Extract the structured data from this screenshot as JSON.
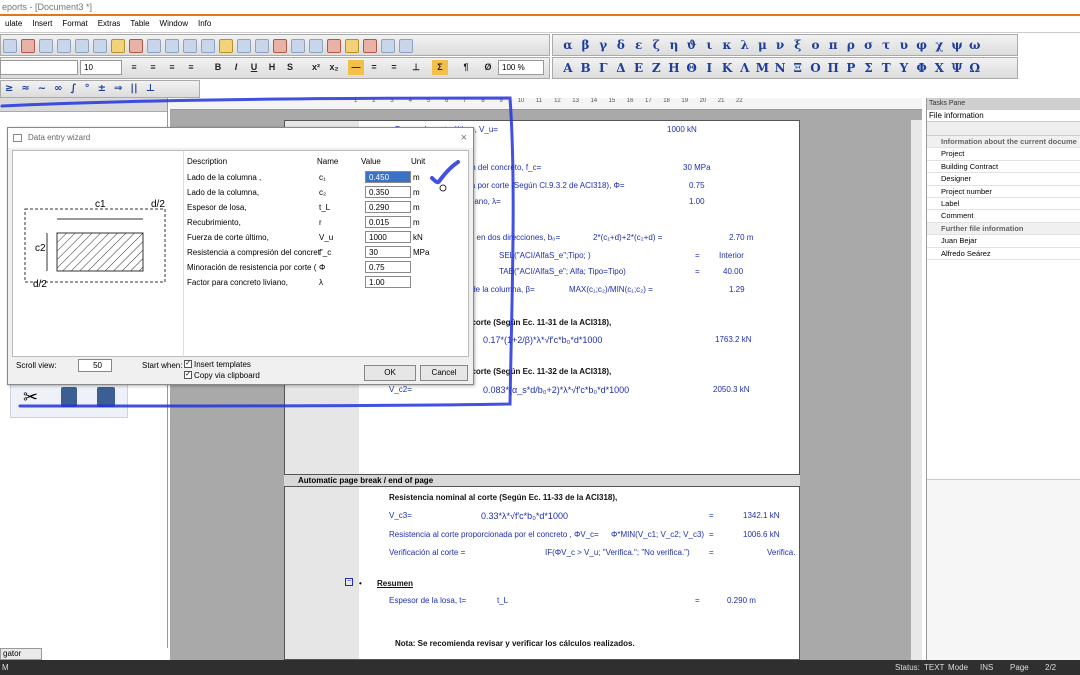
{
  "window": {
    "title": "eports - [Document3 *]"
  },
  "menu": [
    "ulate",
    "Insert",
    "Format",
    "Extras",
    "Table",
    "Window",
    "Info"
  ],
  "toolbar": {
    "font_size": "10",
    "zoom": "100 %"
  },
  "greek_lower": [
    "α",
    "β",
    "γ",
    "δ",
    "ε",
    "ζ",
    "η",
    "ϑ",
    "ι",
    "κ",
    "λ",
    "μ",
    "ν",
    "ξ",
    "ο",
    "π",
    "ρ",
    "σ",
    "τ",
    "υ",
    "φ",
    "χ",
    "ψ",
    "ω"
  ],
  "greek_upper": [
    "Α",
    "Β",
    "Γ",
    "Δ",
    "Ε",
    "Ζ",
    "Η",
    "Θ",
    "Ι",
    "Κ",
    "Λ",
    "Μ",
    "Ν",
    "Ξ",
    "Ο",
    "Π",
    "Ρ",
    "Σ",
    "Τ",
    "Υ",
    "Φ",
    "Χ",
    "Ψ",
    "Ω"
  ],
  "math_symbols": [
    "≥",
    "≈",
    "~",
    "∞",
    "∫",
    "°",
    "±",
    "⇒",
    "||",
    "⊥"
  ],
  "ruler_ticks": [
    "1",
    "2",
    "3",
    "4",
    "5",
    "6",
    "7",
    "8",
    "9",
    "10",
    "11",
    "12",
    "13",
    "14",
    "15",
    "16",
    "17",
    "18",
    "19",
    "20",
    "21",
    "22"
  ],
  "wizard": {
    "title": "Data entry wizard",
    "headers": {
      "description": "Description",
      "name": "Name",
      "value": "Value",
      "unit": "Unit"
    },
    "rows": [
      {
        "desc": "Lado de la columna ,",
        "name": "c₁",
        "value": "0.450",
        "unit": "m"
      },
      {
        "desc": "Lado de la columna,",
        "name": "c₂",
        "value": "0.350",
        "unit": "m"
      },
      {
        "desc": "Espesor de losa,",
        "name": "t_L",
        "value": "0.290",
        "unit": "m"
      },
      {
        "desc": "Recubrimiento,",
        "name": "r",
        "value": "0.015",
        "unit": "m"
      },
      {
        "desc": "Fuerza de corte último,",
        "name": "V_u",
        "value": "1000",
        "unit": "kN"
      },
      {
        "desc": "Resistencia a compresión del concret",
        "name": "f'_c",
        "value": "30",
        "unit": "MPa"
      },
      {
        "desc": "Minoración de resistencia por corte (",
        "name": "Φ",
        "value": "0.75",
        "unit": ""
      },
      {
        "desc": "Factor para concreto liviano,",
        "name": "λ",
        "value": "1.00",
        "unit": ""
      }
    ],
    "diagram": {
      "c1": "c1",
      "c2": "c2",
      "d2_top": "d/2",
      "d2_left": "d/2"
    },
    "scroll_view_label": "Scroll view:",
    "scroll_view_value": "50",
    "start_when_label": "Start when:",
    "insert_templates": "Insert templates",
    "copy_clipboard": "Copy via clipboard",
    "ok": "OK",
    "cancel": "Cancel"
  },
  "page1": [
    {
      "text": "Fuerza de corte último, V_u=",
      "x": "1000 kN"
    },
    {
      "text": "ión del concreto, f_c=",
      "x": "30 MPa"
    },
    {
      "text": "cia por corte (Según Cl.9.3.2 de ACI318), Φ=",
      "x": "0.75"
    },
    {
      "text": "liviano, λ=",
      "x": "1.00"
    },
    {
      "text": "rte en dos direcciones, b₀=",
      "f": "2*(c₁+d)+2*(c₂+d)  =",
      "x": "2.70 m"
    },
    {
      "text": "SEL(\"ACI/AlfaS_e\";Tipo; )",
      "f": "=",
      "x": "Interior"
    },
    {
      "text": "TAB(\"ACI/AlfaS_e\"; Alfa; Tipo=Tipo)",
      "f": "=",
      "x": "40.00"
    },
    {
      "text": "s de la columna, β=",
      "f": "MAX(c₁;c₂)/MIN(c₁;c₂)  =",
      "x": "1.29"
    }
  ],
  "page1_sections": {
    "s1": "l corte (Según Ec. 11-31 de la ACI318),",
    "f1": "0.17*(1+2/β)*λ*√f'c*b₀*d*1000",
    "v1": "1763.2 kN",
    "s2": "l corte (Según Ec. 11-32 de la ACI318),",
    "lbl2": "V_c2=",
    "f2": "0.083*(α_s*d/b₀+2)*λ*√f'c*b₀*d*1000",
    "v2": "2050.3 kN"
  },
  "pagebreak": "Automatic page break / end of page",
  "page2": {
    "s3": "Resistencia nominal al corte (Según Ec. 11-33 de la ACI318),",
    "lbl3": "V_c3=",
    "f3": "0.33*λ*√f'c*b₀*d*1000",
    "eq": "=",
    "v3": "1342.1 kN",
    "lbl4": "Resistencia al corte proporcionada por el concreto , ΦV_c=",
    "f4": "Φ*MIN(V_c1; V_c2; V_c3)",
    "v4": "1006.6 kN",
    "lbl5": "Verificación al corte  =",
    "f5": "IF(ΦV_c > V_u; \"Verifica.\"; \"No verifica.\")",
    "v5": "Verifica.",
    "resumen": "Resumen",
    "lbl6": "Espesor de la losa, t=",
    "f6": "t_L",
    "v6": "0.290 m",
    "nota": "Nota: Se recomienda revisar y verificar los cálculos realizados."
  },
  "tasks": {
    "title": "Tasks Pane",
    "subtitle": "File information",
    "group1": "Information about the current docume",
    "fields": [
      "Project",
      "Building Contract",
      "Designer",
      "Project number",
      "Label",
      "Comment"
    ],
    "group2": "Further file information",
    "people": [
      "Juan Bejar",
      "Alfredo Seárez"
    ]
  },
  "navigator": "gator",
  "status": {
    "label": "Status:",
    "mode1": "TEXT",
    "mode2": "Mode",
    "mode3": "INS",
    "page_label": "Page",
    "page": "2/2",
    "left": "M"
  },
  "annotation_color": "#2233dd"
}
